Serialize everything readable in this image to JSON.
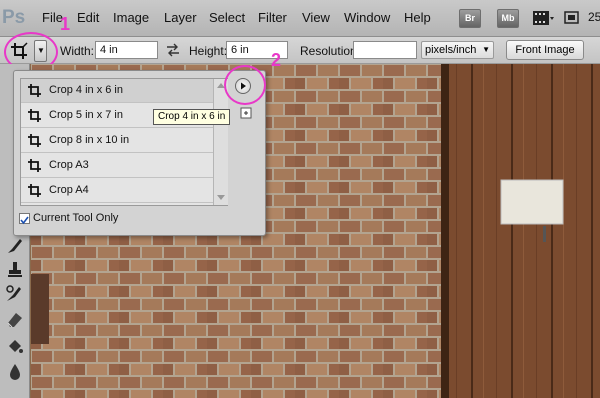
{
  "app": {
    "logo": "Ps",
    "zoom": "25"
  },
  "menu": [
    "File",
    "Edit",
    "Image",
    "Layer",
    "Select",
    "Filter",
    "View",
    "Window",
    "Help"
  ],
  "toolbar_buttons": [
    {
      "label": "Br",
      "icon": "bridge-icon"
    },
    {
      "label": "Mb",
      "icon": "mini-bridge-icon"
    },
    {
      "label": "",
      "icon": "filmstrip-icon"
    }
  ],
  "options": {
    "width_label": "Width:",
    "width_value": "4 in",
    "height_label": "Height:",
    "height_value": "6 in",
    "resolution_label": "Resolution:",
    "resolution_value": "",
    "resolution_unit": "pixels/inch",
    "front_image_button": "Front Image"
  },
  "callouts": {
    "first": "1",
    "second": "2"
  },
  "preset_panel": {
    "presets": [
      {
        "label": "Crop 4 in x 6 in"
      },
      {
        "label": "Crop 5 in x 7 in"
      },
      {
        "label": "Crop 8 in x 10 in"
      },
      {
        "label": "Crop A3"
      },
      {
        "label": "Crop A4"
      }
    ],
    "current_tool_only_label": "Current Tool Only",
    "current_tool_only_checked": true,
    "tooltip": "Crop 4 in x 6 in"
  },
  "colors": {
    "callout": "#e838c8",
    "panel_bg": "#d3d3d3",
    "brick": "#9c6b4f",
    "mortar": "#b8a895",
    "wood": "#7a4a2e"
  }
}
